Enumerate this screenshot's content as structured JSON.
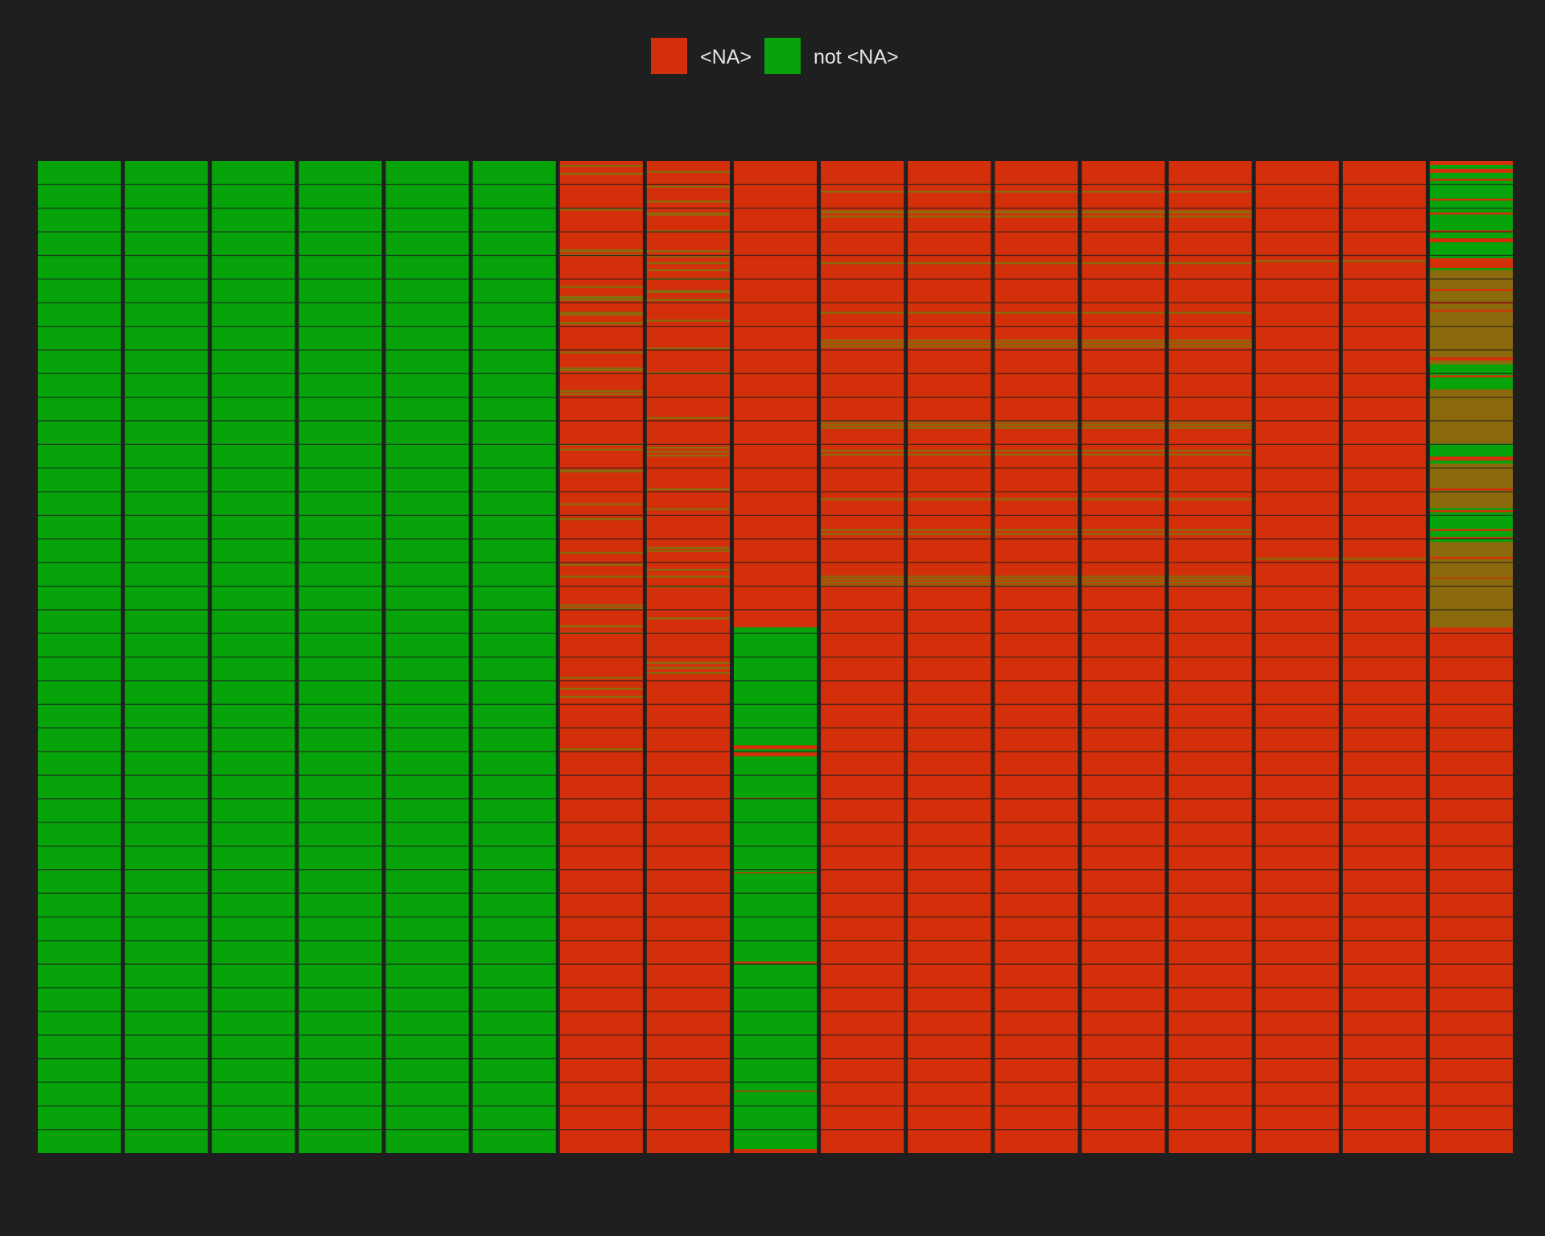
{
  "chart_data": {
    "type": "heatmap",
    "title": "",
    "xlabel": "",
    "ylabel": "",
    "legend": {
      "placement": "top-center",
      "items": [
        {
          "label": "<NA>",
          "color": "#d32f0a"
        },
        {
          "label": "not <NA>",
          "color": "#06a30a"
        }
      ]
    },
    "colors": {
      "background": "#1f1f1f",
      "na": "#d32f0a",
      "not_na": "#06a30a",
      "mixed": "#8a6a0c"
    },
    "grid": true,
    "rows": 1000,
    "columns": [
      {
        "missing_fraction": 0.0
      },
      {
        "missing_fraction": 0.0
      },
      {
        "missing_fraction": 0.0
      },
      {
        "missing_fraction": 0.0
      },
      {
        "missing_fraction": 0.0
      },
      {
        "missing_fraction": 0.0
      },
      {
        "missing_fraction": 0.96,
        "present_bands": [
          [
            0.004,
            0.006
          ],
          [
            0.012,
            0.014
          ],
          [
            0.048,
            0.05
          ],
          [
            0.089,
            0.092
          ],
          [
            0.094,
            0.096
          ],
          [
            0.126,
            0.128
          ],
          [
            0.136,
            0.139
          ],
          [
            0.139,
            0.141
          ],
          [
            0.152,
            0.154
          ],
          [
            0.154,
            0.156
          ],
          [
            0.162,
            0.165
          ],
          [
            0.192,
            0.194
          ],
          [
            0.208,
            0.21
          ],
          [
            0.21,
            0.212
          ],
          [
            0.231,
            0.233
          ],
          [
            0.234,
            0.236
          ],
          [
            0.285,
            0.287
          ],
          [
            0.29,
            0.292
          ],
          [
            0.311,
            0.313
          ],
          [
            0.312,
            0.314
          ],
          [
            0.345,
            0.347
          ],
          [
            0.36,
            0.362
          ],
          [
            0.394,
            0.396
          ],
          [
            0.406,
            0.408
          ],
          [
            0.418,
            0.42
          ],
          [
            0.468,
            0.47
          ],
          [
            0.475,
            0.477
          ],
          [
            0.447,
            0.449
          ],
          [
            0.45,
            0.452
          ],
          [
            0.52,
            0.522
          ],
          [
            0.531,
            0.533
          ],
          [
            0.539,
            0.541
          ],
          [
            0.592,
            0.594
          ]
        ]
      },
      {
        "missing_fraction": 0.96,
        "present_bands": [
          [
            0.01,
            0.012
          ],
          [
            0.025,
            0.027
          ],
          [
            0.04,
            0.042
          ],
          [
            0.052,
            0.055
          ],
          [
            0.07,
            0.072
          ],
          [
            0.09,
            0.092
          ],
          [
            0.095,
            0.097
          ],
          [
            0.102,
            0.104
          ],
          [
            0.109,
            0.111
          ],
          [
            0.118,
            0.12
          ],
          [
            0.13,
            0.133
          ],
          [
            0.139,
            0.141
          ],
          [
            0.16,
            0.162
          ],
          [
            0.188,
            0.19
          ],
          [
            0.213,
            0.215
          ],
          [
            0.258,
            0.26
          ],
          [
            0.288,
            0.29
          ],
          [
            0.292,
            0.294
          ],
          [
            0.296,
            0.298
          ],
          [
            0.33,
            0.332
          ],
          [
            0.35,
            0.352
          ],
          [
            0.389,
            0.391
          ],
          [
            0.392,
            0.394
          ],
          [
            0.411,
            0.413
          ],
          [
            0.418,
            0.42
          ],
          [
            0.428,
            0.43
          ],
          [
            0.46,
            0.462
          ],
          [
            0.505,
            0.507
          ],
          [
            0.51,
            0.512
          ],
          [
            0.515,
            0.517
          ]
        ]
      },
      {
        "missing_fraction": 0.47,
        "missing_bands": [
          [
            0.589,
            0.593
          ],
          [
            0.596,
            0.6
          ],
          [
            0.642,
            0.643
          ],
          [
            0.717,
            0.718
          ],
          [
            0.807,
            0.809
          ],
          [
            0.937,
            0.938
          ],
          [
            0.996,
            1.0
          ]
        ]
      },
      {
        "missing_fraction": 0.99,
        "present_bands": [
          [
            0.03,
            0.032
          ],
          [
            0.05,
            0.053
          ],
          [
            0.055,
            0.057
          ],
          [
            0.102,
            0.104
          ],
          [
            0.152,
            0.154
          ],
          [
            0.18,
            0.182
          ],
          [
            0.183,
            0.185
          ],
          [
            0.186,
            0.188
          ],
          [
            0.262,
            0.264
          ],
          [
            0.265,
            0.267
          ],
          [
            0.268,
            0.27
          ],
          [
            0.291,
            0.293
          ],
          [
            0.295,
            0.297
          ],
          [
            0.34,
            0.342
          ],
          [
            0.371,
            0.373
          ],
          [
            0.375,
            0.377
          ],
          [
            0.418,
            0.42
          ],
          [
            0.421,
            0.423
          ],
          [
            0.424,
            0.426
          ],
          [
            0.427,
            0.429
          ]
        ]
      },
      {
        "missing_fraction": 0.99,
        "present_bands": [
          [
            0.03,
            0.032
          ],
          [
            0.05,
            0.053
          ],
          [
            0.055,
            0.057
          ],
          [
            0.102,
            0.104
          ],
          [
            0.152,
            0.154
          ],
          [
            0.18,
            0.182
          ],
          [
            0.183,
            0.185
          ],
          [
            0.186,
            0.188
          ],
          [
            0.262,
            0.264
          ],
          [
            0.265,
            0.267
          ],
          [
            0.268,
            0.27
          ],
          [
            0.291,
            0.293
          ],
          [
            0.295,
            0.297
          ],
          [
            0.34,
            0.342
          ],
          [
            0.371,
            0.373
          ],
          [
            0.375,
            0.377
          ],
          [
            0.418,
            0.42
          ],
          [
            0.421,
            0.423
          ],
          [
            0.424,
            0.426
          ],
          [
            0.427,
            0.429
          ]
        ]
      },
      {
        "missing_fraction": 0.99,
        "present_bands": [
          [
            0.03,
            0.032
          ],
          [
            0.05,
            0.053
          ],
          [
            0.055,
            0.057
          ],
          [
            0.102,
            0.104
          ],
          [
            0.152,
            0.154
          ],
          [
            0.18,
            0.182
          ],
          [
            0.183,
            0.185
          ],
          [
            0.186,
            0.188
          ],
          [
            0.262,
            0.264
          ],
          [
            0.265,
            0.267
          ],
          [
            0.268,
            0.27
          ],
          [
            0.291,
            0.293
          ],
          [
            0.295,
            0.297
          ],
          [
            0.34,
            0.342
          ],
          [
            0.371,
            0.373
          ],
          [
            0.375,
            0.377
          ],
          [
            0.418,
            0.42
          ],
          [
            0.421,
            0.423
          ],
          [
            0.424,
            0.426
          ],
          [
            0.427,
            0.429
          ]
        ]
      },
      {
        "missing_fraction": 0.99,
        "present_bands": [
          [
            0.03,
            0.032
          ],
          [
            0.05,
            0.053
          ],
          [
            0.055,
            0.057
          ],
          [
            0.102,
            0.104
          ],
          [
            0.152,
            0.154
          ],
          [
            0.18,
            0.182
          ],
          [
            0.183,
            0.185
          ],
          [
            0.186,
            0.188
          ],
          [
            0.262,
            0.264
          ],
          [
            0.265,
            0.267
          ],
          [
            0.268,
            0.27
          ],
          [
            0.291,
            0.293
          ],
          [
            0.295,
            0.297
          ],
          [
            0.34,
            0.342
          ],
          [
            0.371,
            0.373
          ],
          [
            0.375,
            0.377
          ],
          [
            0.418,
            0.42
          ],
          [
            0.421,
            0.423
          ],
          [
            0.424,
            0.426
          ],
          [
            0.427,
            0.429
          ]
        ]
      },
      {
        "missing_fraction": 0.99,
        "present_bands": [
          [
            0.03,
            0.032
          ],
          [
            0.05,
            0.053
          ],
          [
            0.055,
            0.057
          ],
          [
            0.102,
            0.104
          ],
          [
            0.152,
            0.154
          ],
          [
            0.18,
            0.182
          ],
          [
            0.183,
            0.185
          ],
          [
            0.186,
            0.188
          ],
          [
            0.262,
            0.264
          ],
          [
            0.265,
            0.267
          ],
          [
            0.268,
            0.27
          ],
          [
            0.291,
            0.293
          ],
          [
            0.295,
            0.297
          ],
          [
            0.34,
            0.342
          ],
          [
            0.371,
            0.373
          ],
          [
            0.375,
            0.377
          ],
          [
            0.418,
            0.42
          ],
          [
            0.421,
            0.423
          ],
          [
            0.424,
            0.426
          ],
          [
            0.427,
            0.429
          ]
        ]
      },
      {
        "missing_fraction": 1.0,
        "present_bands": [
          [
            0.1,
            0.102
          ],
          [
            0.4,
            0.402
          ]
        ]
      },
      {
        "missing_fraction": 1.0,
        "present_bands": [
          [
            0.1,
            0.102
          ],
          [
            0.4,
            0.402
          ]
        ]
      },
      {
        "missing_fraction": 0.62,
        "missing_bands": [
          [
            0.0,
            0.004
          ],
          [
            0.008,
            0.012
          ],
          [
            0.018,
            0.02
          ],
          [
            0.038,
            0.04
          ],
          [
            0.052,
            0.054
          ],
          [
            0.07,
            0.072
          ],
          [
            0.078,
            0.082
          ],
          [
            0.098,
            0.108
          ],
          [
            0.129,
            0.131
          ],
          [
            0.142,
            0.144
          ],
          [
            0.15,
            0.152
          ],
          [
            0.198,
            0.201
          ],
          [
            0.216,
            0.218
          ],
          [
            0.298,
            0.3
          ],
          [
            0.3,
            0.302
          ],
          [
            0.3,
            0.301
          ],
          [
            0.33,
            0.332
          ],
          [
            0.352,
            0.354
          ],
          [
            0.371,
            0.373
          ],
          [
            0.379,
            0.381
          ],
          [
            0.399,
            0.401
          ],
          [
            0.42,
            0.421
          ],
          [
            0.47,
            0.472
          ],
          [
            0.0,
            0.0
          ],
          [
            0.472,
            1.0
          ]
        ],
        "mixed_bands": [
          [
            0.11,
            0.205
          ],
          [
            0.23,
            0.285
          ],
          [
            0.305,
            0.35
          ],
          [
            0.384,
            0.47
          ],
          [
            0.48,
            0.49
          ],
          [
            0.5,
            0.52
          ],
          [
            0.555,
            0.57
          ],
          [
            0.58,
            0.6
          ]
        ]
      }
    ]
  }
}
